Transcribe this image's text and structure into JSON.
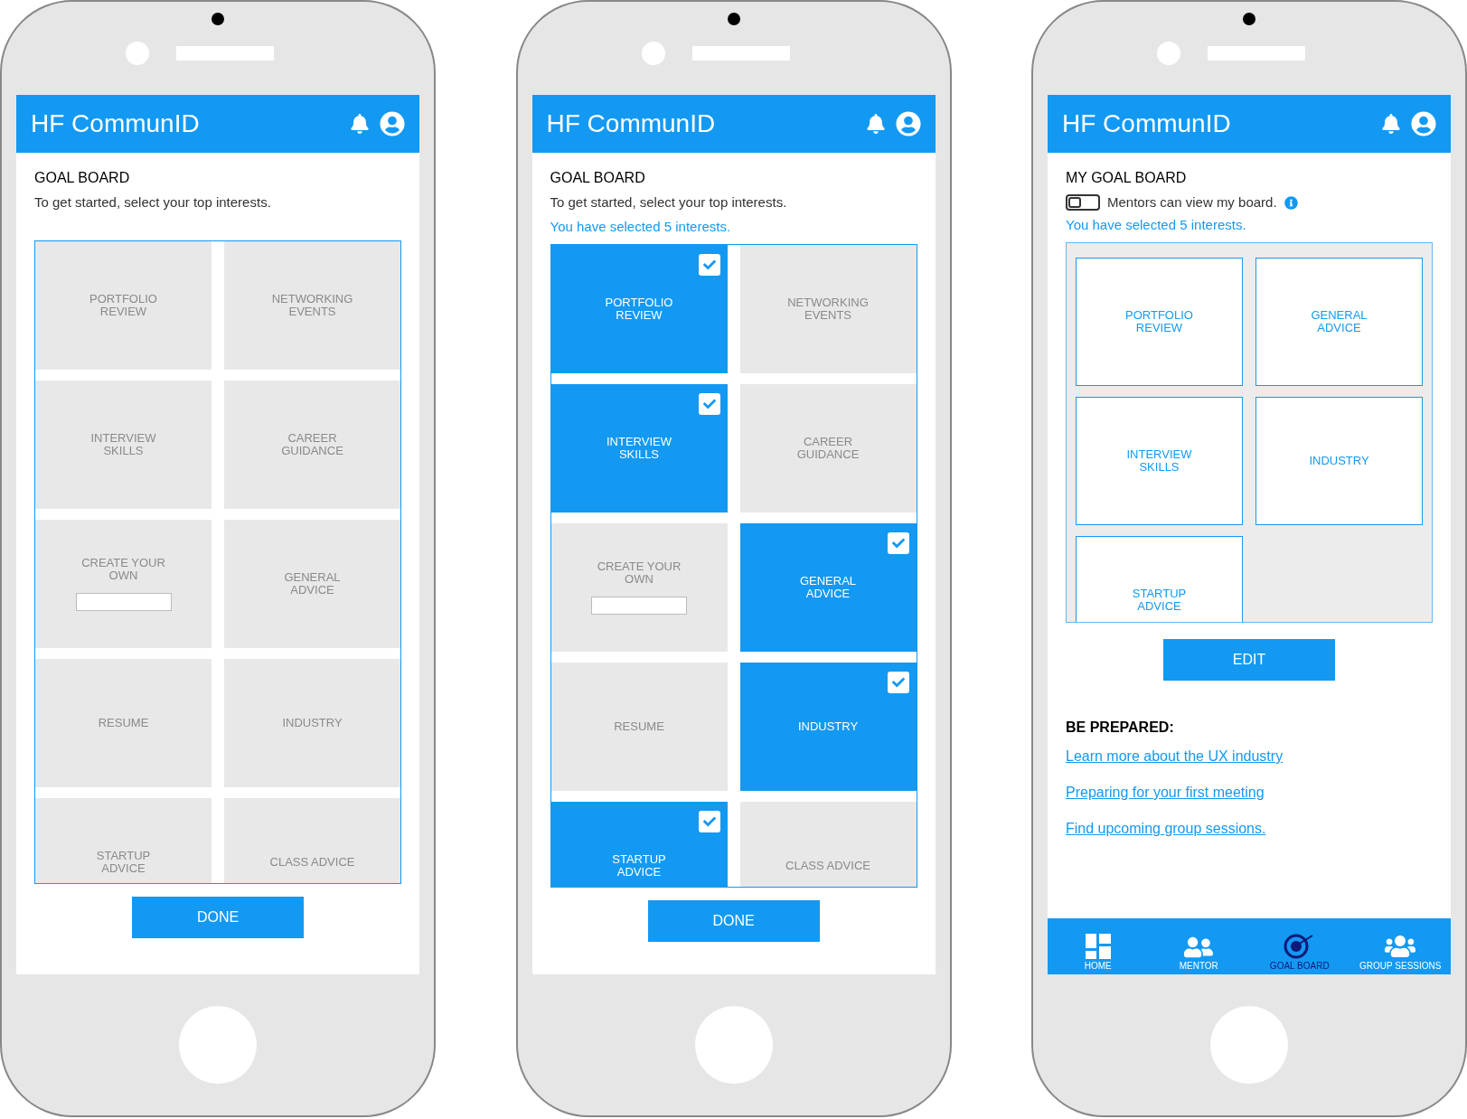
{
  "phones": [
    {
      "kind": "picker",
      "header": {
        "title": "HF CommunID"
      },
      "heading": "GOAL BOARD",
      "intro": "To get started, select your top interests.",
      "tiles": [
        {
          "label": "PORTFOLIO REVIEW",
          "kind": "preset",
          "selected": false
        },
        {
          "label": "NETWORKING EVENTS",
          "kind": "preset",
          "selected": false
        },
        {
          "label": "INTERVIEW SKILLS",
          "kind": "preset",
          "selected": false
        },
        {
          "label": "CAREER GUIDANCE",
          "kind": "preset",
          "selected": false
        },
        {
          "label": "CREATE YOUR OWN",
          "kind": "custom",
          "selected": false
        },
        {
          "label": "GENERAL ADVICE",
          "kind": "preset",
          "selected": false
        },
        {
          "label": "RESUME",
          "kind": "preset",
          "selected": false
        },
        {
          "label": "INDUSTRY",
          "kind": "preset",
          "selected": false
        },
        {
          "label": "STARTUP ADVICE",
          "kind": "preset",
          "selected": false
        },
        {
          "label": "CLASS ADVICE",
          "kind": "preset",
          "selected": false
        }
      ],
      "button": "DONE"
    },
    {
      "kind": "picker",
      "header": {
        "title": "HF CommunID"
      },
      "heading": "GOAL BOARD",
      "intro": "To get started, select your top interests.",
      "selection_note": "You have selected 5 interests.",
      "tiles": [
        {
          "label": "PORTFOLIO REVIEW",
          "kind": "preset",
          "selected": true
        },
        {
          "label": "NETWORKING EVENTS",
          "kind": "preset",
          "selected": false
        },
        {
          "label": "INTERVIEW SKILLS",
          "kind": "preset",
          "selected": true
        },
        {
          "label": "CAREER GUIDANCE",
          "kind": "preset",
          "selected": false
        },
        {
          "label": "CREATE YOUR OWN",
          "kind": "custom",
          "selected": false
        },
        {
          "label": "GENERAL ADVICE",
          "kind": "preset",
          "selected": true
        },
        {
          "label": "RESUME",
          "kind": "preset",
          "selected": false
        },
        {
          "label": "INDUSTRY",
          "kind": "preset",
          "selected": true
        },
        {
          "label": "STARTUP ADVICE",
          "kind": "preset",
          "selected": true
        },
        {
          "label": "CLASS ADVICE",
          "kind": "preset",
          "selected": false
        }
      ],
      "button": "DONE"
    },
    {
      "kind": "board",
      "header": {
        "title": "HF CommunID"
      },
      "heading": "MY GOAL BOARD",
      "toggle": {
        "label": "Mentors can view my board.",
        "on": false
      },
      "selection_note": "You have selected 5 interests.",
      "tiles": [
        {
          "label": "PORTFOLIO REVIEW"
        },
        {
          "label": "GENERAL ADVICE"
        },
        {
          "label": "INTERVIEW SKILLS"
        },
        {
          "label": "INDUSTRY"
        },
        {
          "label": "STARTUP ADVICE"
        }
      ],
      "button": "EDIT",
      "resources": {
        "heading": "BE PREPARED:",
        "links": [
          "Learn more about the UX industry",
          "Preparing for your first meeting",
          "Find upcoming group sessions."
        ]
      },
      "nav": [
        {
          "kind": "home",
          "label": "HOME",
          "selected": false
        },
        {
          "kind": "mentor",
          "label": "MENTOR",
          "selected": false
        },
        {
          "kind": "goal",
          "label": "GOAL BOARD",
          "selected": true
        },
        {
          "kind": "group",
          "label": "GROUP SESSIONS",
          "selected": false
        }
      ]
    }
  ]
}
